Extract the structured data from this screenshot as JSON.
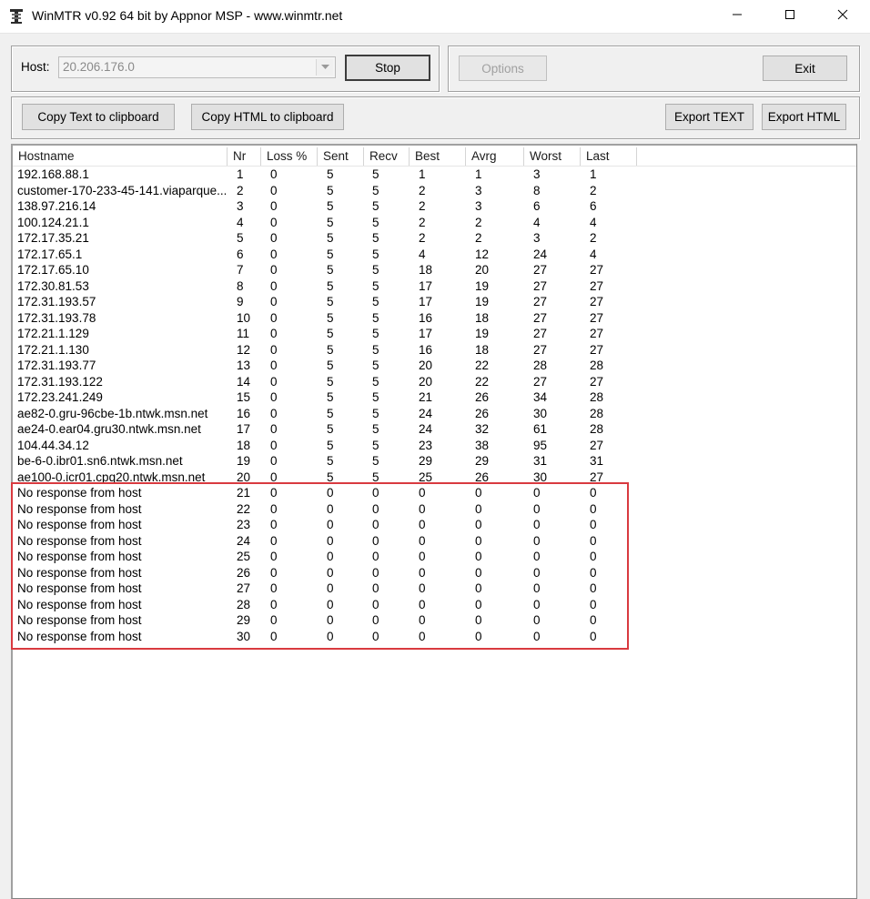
{
  "window": {
    "title": "WinMTR v0.92 64 bit by Appnor MSP - www.winmtr.net",
    "icon": "winmtr-app-icon"
  },
  "host": {
    "label": "Host:",
    "value": "20.206.176.0"
  },
  "buttons": {
    "stop": "Stop",
    "options": "Options",
    "exit": "Exit",
    "copy_text": "Copy Text to clipboard",
    "copy_html": "Copy HTML to clipboard",
    "export_text": "Export TEXT",
    "export_html": "Export HTML"
  },
  "table": {
    "columns": [
      "Hostname",
      "Nr",
      "Loss %",
      "Sent",
      "Recv",
      "Best",
      "Avrg",
      "Worst",
      "Last"
    ],
    "rows": [
      [
        "192.168.88.1",
        "1",
        "0",
        "5",
        "5",
        "1",
        "1",
        "3",
        "1"
      ],
      [
        "customer-170-233-45-141.viaparque....",
        "2",
        "0",
        "5",
        "5",
        "2",
        "3",
        "8",
        "2"
      ],
      [
        "138.97.216.14",
        "3",
        "0",
        "5",
        "5",
        "2",
        "3",
        "6",
        "6"
      ],
      [
        "100.124.21.1",
        "4",
        "0",
        "5",
        "5",
        "2",
        "2",
        "4",
        "4"
      ],
      [
        "172.17.35.21",
        "5",
        "0",
        "5",
        "5",
        "2",
        "2",
        "3",
        "2"
      ],
      [
        "172.17.65.1",
        "6",
        "0",
        "5",
        "5",
        "4",
        "12",
        "24",
        "4"
      ],
      [
        "172.17.65.10",
        "7",
        "0",
        "5",
        "5",
        "18",
        "20",
        "27",
        "27"
      ],
      [
        "172.30.81.53",
        "8",
        "0",
        "5",
        "5",
        "17",
        "19",
        "27",
        "27"
      ],
      [
        "172.31.193.57",
        "9",
        "0",
        "5",
        "5",
        "17",
        "19",
        "27",
        "27"
      ],
      [
        "172.31.193.78",
        "10",
        "0",
        "5",
        "5",
        "16",
        "18",
        "27",
        "27"
      ],
      [
        "172.21.1.129",
        "11",
        "0",
        "5",
        "5",
        "17",
        "19",
        "27",
        "27"
      ],
      [
        "172.21.1.130",
        "12",
        "0",
        "5",
        "5",
        "16",
        "18",
        "27",
        "27"
      ],
      [
        "172.31.193.77",
        "13",
        "0",
        "5",
        "5",
        "20",
        "22",
        "28",
        "28"
      ],
      [
        "172.31.193.122",
        "14",
        "0",
        "5",
        "5",
        "20",
        "22",
        "27",
        "27"
      ],
      [
        "172.23.241.249",
        "15",
        "0",
        "5",
        "5",
        "21",
        "26",
        "34",
        "28"
      ],
      [
        "ae82-0.gru-96cbe-1b.ntwk.msn.net",
        "16",
        "0",
        "5",
        "5",
        "24",
        "26",
        "30",
        "28"
      ],
      [
        "ae24-0.ear04.gru30.ntwk.msn.net",
        "17",
        "0",
        "5",
        "5",
        "24",
        "32",
        "61",
        "28"
      ],
      [
        "104.44.34.12",
        "18",
        "0",
        "5",
        "5",
        "23",
        "38",
        "95",
        "27"
      ],
      [
        "be-6-0.ibr01.sn6.ntwk.msn.net",
        "19",
        "0",
        "5",
        "5",
        "29",
        "29",
        "31",
        "31"
      ],
      [
        "ae100-0.icr01.cpq20.ntwk.msn.net",
        "20",
        "0",
        "5",
        "5",
        "25",
        "26",
        "30",
        "27"
      ],
      [
        "No response from host",
        "21",
        "0",
        "0",
        "0",
        "0",
        "0",
        "0",
        "0"
      ],
      [
        "No response from host",
        "22",
        "0",
        "0",
        "0",
        "0",
        "0",
        "0",
        "0"
      ],
      [
        "No response from host",
        "23",
        "0",
        "0",
        "0",
        "0",
        "0",
        "0",
        "0"
      ],
      [
        "No response from host",
        "24",
        "0",
        "0",
        "0",
        "0",
        "0",
        "0",
        "0"
      ],
      [
        "No response from host",
        "25",
        "0",
        "0",
        "0",
        "0",
        "0",
        "0",
        "0"
      ],
      [
        "No response from host",
        "26",
        "0",
        "0",
        "0",
        "0",
        "0",
        "0",
        "0"
      ],
      [
        "No response from host",
        "27",
        "0",
        "0",
        "0",
        "0",
        "0",
        "0",
        "0"
      ],
      [
        "No response from host",
        "28",
        "0",
        "0",
        "0",
        "0",
        "0",
        "0",
        "0"
      ],
      [
        "No response from host",
        "29",
        "0",
        "0",
        "0",
        "0",
        "0",
        "0",
        "0"
      ],
      [
        "No response from host",
        "30",
        "0",
        "0",
        "0",
        "0",
        "0",
        "0",
        "0"
      ]
    ]
  },
  "colors": {
    "highlight_border": "#d93a3f",
    "window_background": "#f0f0f0"
  }
}
